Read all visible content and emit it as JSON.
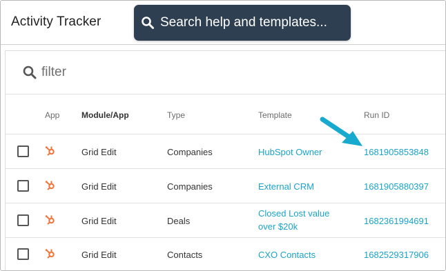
{
  "app": {
    "title": "Activity Tracker"
  },
  "search": {
    "label": "Search help and templates..."
  },
  "filter": {
    "placeholder": "filter"
  },
  "columns": {
    "app": "App",
    "module": "Module/App",
    "type": "Type",
    "template": "Template",
    "run_id": "Run ID"
  },
  "rows": [
    {
      "module": "Grid Edit",
      "type": "Companies",
      "template_line1": "HubSpot Owner",
      "template_line2": "",
      "run_id": "1681905853848"
    },
    {
      "module": "Grid Edit",
      "type": "Companies",
      "template_line1": "External CRM",
      "template_line2": "",
      "run_id": "1681905880397"
    },
    {
      "module": "Grid Edit",
      "type": "Deals",
      "template_line1": "Closed Lost value",
      "template_line2": "over $20k",
      "run_id": "1682361994691"
    },
    {
      "module": "Grid Edit",
      "type": "Contacts",
      "template_line1": "CXO Contacts",
      "template_line2": "",
      "run_id": "1682529317906"
    }
  ],
  "colors": {
    "link": "#1aa3c9",
    "hubspot": "#f0743a",
    "search_bg": "#2e3f52",
    "arrow": "#18a9cf"
  },
  "icons": {
    "search": "search-icon",
    "filter": "magnifier-icon",
    "app": "hubspot-sprocket-icon",
    "pointer": "arrow-pointer-icon"
  }
}
